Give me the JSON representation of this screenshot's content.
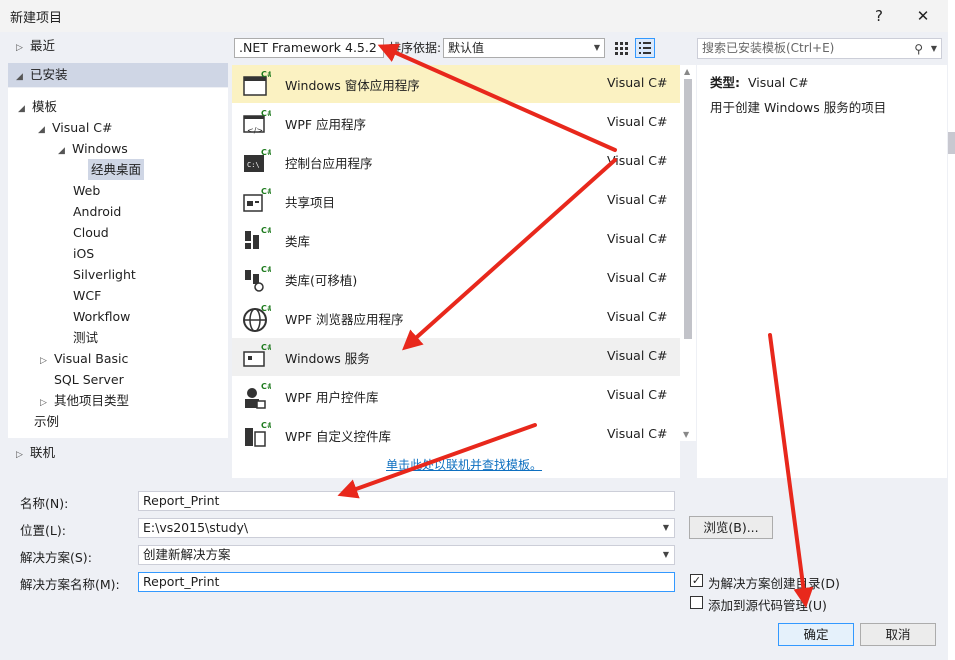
{
  "window": {
    "title": "新建项目",
    "help": "?",
    "close": "✕"
  },
  "tree": {
    "recent": "最近",
    "installed": "已安装",
    "templates": "模板",
    "visual_csharp": "Visual C#",
    "windows": "Windows",
    "classic_desktop": "经典桌面",
    "web": "Web",
    "android": "Android",
    "cloud": "Cloud",
    "ios": "iOS",
    "silverlight": "Silverlight",
    "wcf": "WCF",
    "workflow": "Workflow",
    "test": "测试",
    "visual_basic": "Visual Basic",
    "sql_server": "SQL Server",
    "other_project_types": "其他项目类型",
    "samples": "示例",
    "online": "联机"
  },
  "toolbar": {
    "framework": ".NET Framework 4.5.2",
    "sort_label": "排序依据:",
    "sort_value": "默认值",
    "search_placeholder": "搜索已安装模板(Ctrl+E)"
  },
  "templates": [
    {
      "name": "Windows 窗体应用程序",
      "lang": "Visual C#",
      "icon": "windows-forms-icon"
    },
    {
      "name": "WPF 应用程序",
      "lang": "Visual C#",
      "icon": "wpf-app-icon"
    },
    {
      "name": "控制台应用程序",
      "lang": "Visual C#",
      "icon": "console-app-icon"
    },
    {
      "name": "共享项目",
      "lang": "Visual C#",
      "icon": "shared-project-icon"
    },
    {
      "name": "类库",
      "lang": "Visual C#",
      "icon": "class-library-icon"
    },
    {
      "name": "类库(可移植)",
      "lang": "Visual C#",
      "icon": "portable-library-icon"
    },
    {
      "name": "WPF 浏览器应用程序",
      "lang": "Visual C#",
      "icon": "wpf-browser-icon"
    },
    {
      "name": "Windows 服务",
      "lang": "Visual C#",
      "icon": "windows-service-icon"
    },
    {
      "name": "WPF 用户控件库",
      "lang": "Visual C#",
      "icon": "wpf-user-control-icon"
    },
    {
      "name": "WPF 自定义控件库",
      "lang": "Visual C#",
      "icon": "wpf-custom-control-icon"
    }
  ],
  "online_link": "单击此处以联机并查找模板。",
  "detail": {
    "type_label": "类型:",
    "type_value": "Visual C#",
    "description": "用于创建 Windows 服务的项目"
  },
  "form": {
    "name_label": "名称(N):",
    "name_value": "Report_Print",
    "location_label": "位置(L):",
    "location_value": "E:\\vs2015\\study\\",
    "solution_label": "解决方案(S):",
    "solution_value": "创建新解决方案",
    "solution_name_label": "解决方案名称(M):",
    "solution_name_value": "Report_Print",
    "browse_button": "浏览(B)...",
    "create_dir_label": "为解决方案创建目录(D)",
    "create_dir_checked": true,
    "source_control_label": "添加到源代码管理(U)",
    "source_control_checked": false,
    "ok_button": "确定",
    "cancel_button": "取消"
  },
  "colors": {
    "arrow": "#e8281c",
    "selection": "#fbf2c2",
    "accent": "#3399ff",
    "link": "#0e70c0"
  }
}
